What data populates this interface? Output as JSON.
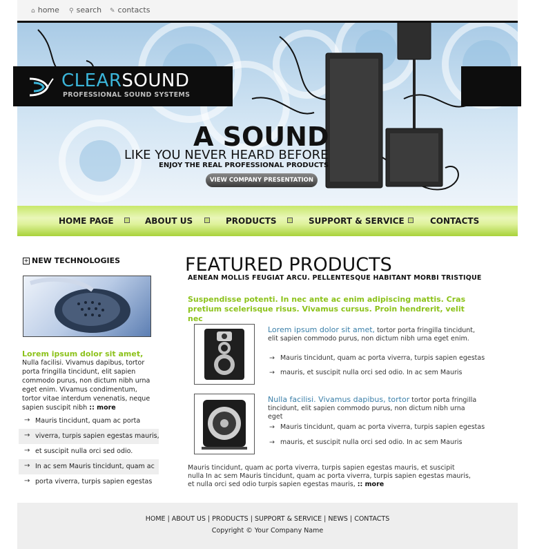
{
  "top_links": [
    {
      "icon": "home-icon",
      "label": "home"
    },
    {
      "icon": "search-icon",
      "label": "search"
    },
    {
      "icon": "contacts-icon",
      "label": "contacts"
    }
  ],
  "brand": {
    "name_part1": "CLEAR",
    "name_part2": "SOUND",
    "subtitle": "PROFESSIONAL SOUND SYSTEMS"
  },
  "hero": {
    "headline": "A SOUND",
    "subline": "LIKE YOU NEVER HEARD BEFORE",
    "tagline": "ENJOY THE REAL PROFESSIONAL PRODUCTS",
    "button_label": "VIEW COMPANY PRESENTATION"
  },
  "nav": [
    "HOME PAGE",
    "ABOUT US",
    "PRODUCTS",
    "SUPPORT & SERVICE",
    "CONTACTS"
  ],
  "sidebar": {
    "heading": "NEW TECHNOLOGIES",
    "title": "Lorem ipsum dolor sit amet,",
    "text": "Nulla facilisi. Vivamus dapibus, tortor porta fringilla tincidunt, elit sapien commodo purus, non dictum nibh urna eget enim. Vivamus condimentum, tortor vitae interdum venenatis, neque sapien suscipit nibh",
    "more": ":: more",
    "list": [
      "Mauris tincidunt, quam ac porta",
      "viverra, turpis sapien egestas mauris,",
      "et suscipit nulla orci sed odio.",
      "In ac sem Mauris tincidunt, quam ac",
      "porta viverra, turpis sapien egestas"
    ]
  },
  "main": {
    "title": "FEATURED PRODUCTS",
    "subtitle": "AENEAN MOLLIS FEUGIAT ARCU. PELLENTESQUE HABITANT MORBI TRISTIQUE",
    "intro": "Suspendisse potenti. In nec ante ac enim adipiscing mattis. Cras pretium scelerisque risus. Vivamus cursus. Proin hendrerit, velit nec",
    "products": [
      {
        "title": "Lorem ipsum dolor sit amet,",
        "desc": "tortor porta fringilla tincidunt, elit sapien commodo purus, non dictum nibh urna eget enim.",
        "bullets": [
          "Mauris tincidunt, quam ac porta viverra, turpis sapien egestas",
          "mauris, et suscipit nulla orci sed odio. In ac sem Mauris"
        ]
      },
      {
        "title": "Nulla facilisi. Vivamus dapibus, tortor",
        "desc": "tortor porta fringilla tincidunt, elit sapien commodo purus, non dictum nibh urna eget",
        "bullets": [
          "Mauris tincidunt, quam ac porta viverra, turpis sapien egestas",
          "mauris, et suscipit nulla orci sed odio. In ac sem Mauris"
        ]
      }
    ],
    "bottom_text": "Mauris tincidunt, quam ac porta viverra, turpis sapien egestas mauris, et suscipit nulla In ac sem Mauris tincidunt, quam ac porta viverra, turpis sapien egestas mauris, et nulla orci sed odio turpis sapien egestas mauris,",
    "more": ":: more"
  },
  "footer": {
    "links": [
      "HOME",
      "ABOUT US",
      "PRODUCTS",
      "SUPPORT & SERVICE",
      "NEWS",
      "CONTACTS"
    ],
    "separator": "|",
    "copyright": "Copyright © Your Company Name"
  },
  "colors": {
    "accent_green": "#8cc21a",
    "link_blue": "#3a7fa8",
    "nav_green": "#c8e86a",
    "brand_cyan": "#3bb5d9"
  }
}
